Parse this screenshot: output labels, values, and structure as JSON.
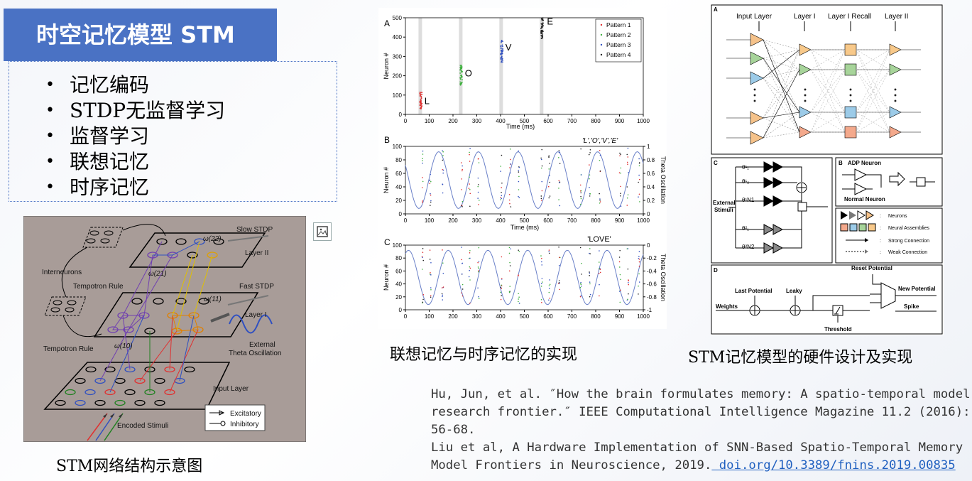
{
  "slide": {
    "title": "时空记忆模型 STM",
    "bullets": [
      "记忆编码",
      "STDP无监督学习",
      "监督学习",
      "联想记忆",
      "时序记忆"
    ]
  },
  "figures": {
    "network": {
      "caption": "STM网络结构示意图",
      "labels": {
        "slow_stdp": "Slow STDP",
        "layer2": "Layer II",
        "interneurons": "Interneurons",
        "tempotron1": "Tempotron Rule",
        "fast_stdp": "Fast STDP",
        "layer1": "Layer I",
        "tempotron2": "Tempotron Rule",
        "theta": "External",
        "theta2": "Theta Oscillation",
        "input": "Input Layer",
        "stimuli": "Encoded Stimuli",
        "excitatory": "Excitatory",
        "inhibitory": "Inhibitory",
        "w22": "ω(22)",
        "w21": "ω(21)",
        "w11": "ω(11)",
        "w10": "ω(10)"
      }
    },
    "raster": {
      "caption": "联想记忆与时序记忆的实现",
      "panelA": {
        "label": "A",
        "ylabel": "Neuron #",
        "xlabel": "Time (ms)",
        "yticks": [
          "0",
          "100",
          "200",
          "300",
          "400",
          "500"
        ],
        "xticks": [
          "0",
          "100",
          "200",
          "300",
          "400",
          "500",
          "600",
          "700",
          "800",
          "900",
          "1000"
        ],
        "letters": [
          "L",
          "O",
          "V",
          "E"
        ],
        "legend": [
          "Pattern 1",
          "Pattern 2",
          "Pattern 3",
          "Pattern 4"
        ]
      },
      "panelB": {
        "label": "B",
        "title": "'L','O','V','E'",
        "ylabel": "Neuron #",
        "y2label": "Theta Oscillation",
        "xlabel": "Time (ms)",
        "yticks": [
          "0",
          "20",
          "40",
          "60",
          "80",
          "100"
        ],
        "y2ticks": [
          "0",
          "0.2",
          "0.4",
          "0.6",
          "0.8",
          "1"
        ],
        "xticks": [
          "0",
          "100",
          "200",
          "300",
          "400",
          "500",
          "600",
          "700",
          "800",
          "900",
          "1000"
        ]
      },
      "panelC": {
        "label": "C",
        "title": "'LOVE'",
        "ylabel": "Neuron #",
        "y2label": "Theta Oscillation",
        "yticks": [
          "0",
          "20",
          "40",
          "60",
          "80",
          "100"
        ],
        "y2ticks": [
          "-1",
          "-0.8",
          "-0.6",
          "-0.4",
          "-0.2",
          "0"
        ],
        "xticks": [
          "0",
          "100",
          "200",
          "300",
          "400",
          "500",
          "600",
          "700",
          "800",
          "900",
          "1000"
        ]
      }
    },
    "hardware": {
      "caption": "STM记忆模型的硬件设计及实现",
      "panelA": {
        "label": "A",
        "cols": [
          "Input Layer",
          "Layer I",
          "Layer I Recall",
          "Layer II"
        ]
      },
      "panelB": {
        "label": "B",
        "adp": "ADP Neuron",
        "normal": "Normal Neuron"
      },
      "panelC": {
        "label": "C",
        "ext1": "External",
        "ext2": "Stimuli",
        "thetas": [
          "θ¹₁",
          "θ¹₂",
          "θ¹N1",
          "θ²₁",
          "θ²N2"
        ]
      },
      "legend": {
        "neurons": "Neurons",
        "assemblies": "Neural Assemblies",
        "strong": "Strong Connection",
        "weak": "Weak Connection"
      },
      "panelD": {
        "label": "D",
        "reset": "Reset Potential",
        "last": "Last Potential",
        "leaky": "Leaky",
        "new": "New Potential",
        "weights": "Weights",
        "spike": "Spike",
        "threshold": "Threshold"
      }
    }
  },
  "references": {
    "line1": "Hu, Jun, et al. ″How the brain formulates memory: A spatio-temporal model",
    "line2": "research frontier.″ IEEE Computational Intelligence Magazine 11.2 (2016):",
    "line3": "56-68.",
    "line4": "Liu et al, A Hardware Implementation of SNN-Based Spatio-Temporal Memory",
    "line5": "Model Frontiers in Neuroscience, 2019.",
    "link": " doi.org/10.3389/fnins.2019.00835"
  },
  "colors": {
    "title_bg": "#4a72c4",
    "pattern1": "#e03030",
    "pattern2": "#40b040",
    "pattern3": "#3050c0",
    "pattern4": "#202020",
    "figure_bg": "#a89c98"
  }
}
